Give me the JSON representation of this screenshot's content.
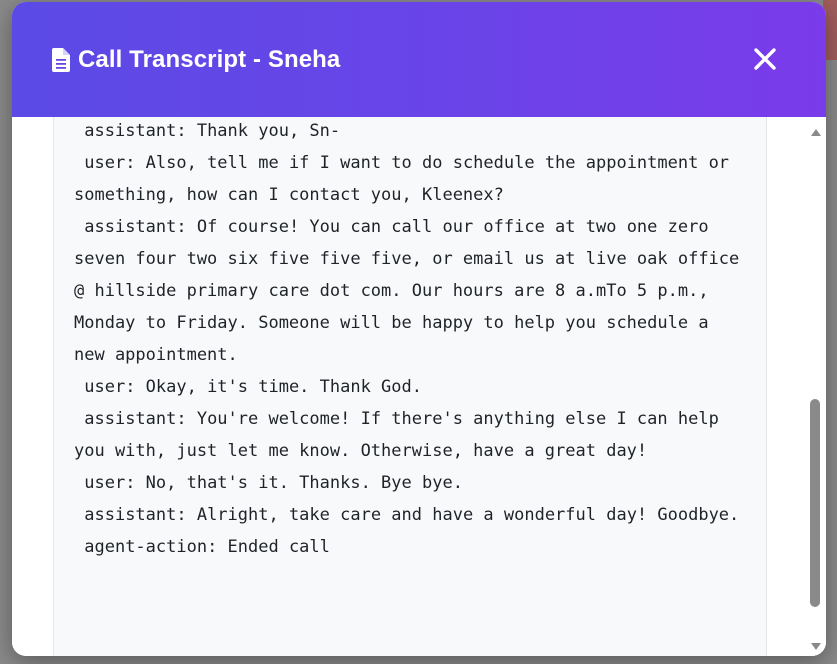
{
  "modal": {
    "title": "Call Transcript - Sneha",
    "header_gradient": [
      "#5b4ae6",
      "#7a3bea"
    ],
    "icons": {
      "title_icon": "document-icon",
      "close_icon": "close-icon"
    }
  },
  "transcript": {
    "lines": [
      " assistant: Thank you, Sn-",
      " user: Also, tell me if I want to do schedule the appointment or something, how can I contact you, Kleenex?",
      " assistant: Of course! You can call our office at two one zero seven four two six five five five, or email us at live oak office @ hillside primary care dot com. Our hours are 8 a.mTo 5 p.m., Monday to Friday. Someone will be happy to help you schedule a new appointment.",
      " user: Okay, it's time. Thank God.",
      " assistant: You're welcome! If there's anything else I can help you with, just let me know. Otherwise, have a great day!",
      " user: No, that's it. Thanks. Bye bye.",
      " assistant: Alright, take care and have a wonderful day! Goodbye.",
      " agent-action: Ended call"
    ]
  }
}
